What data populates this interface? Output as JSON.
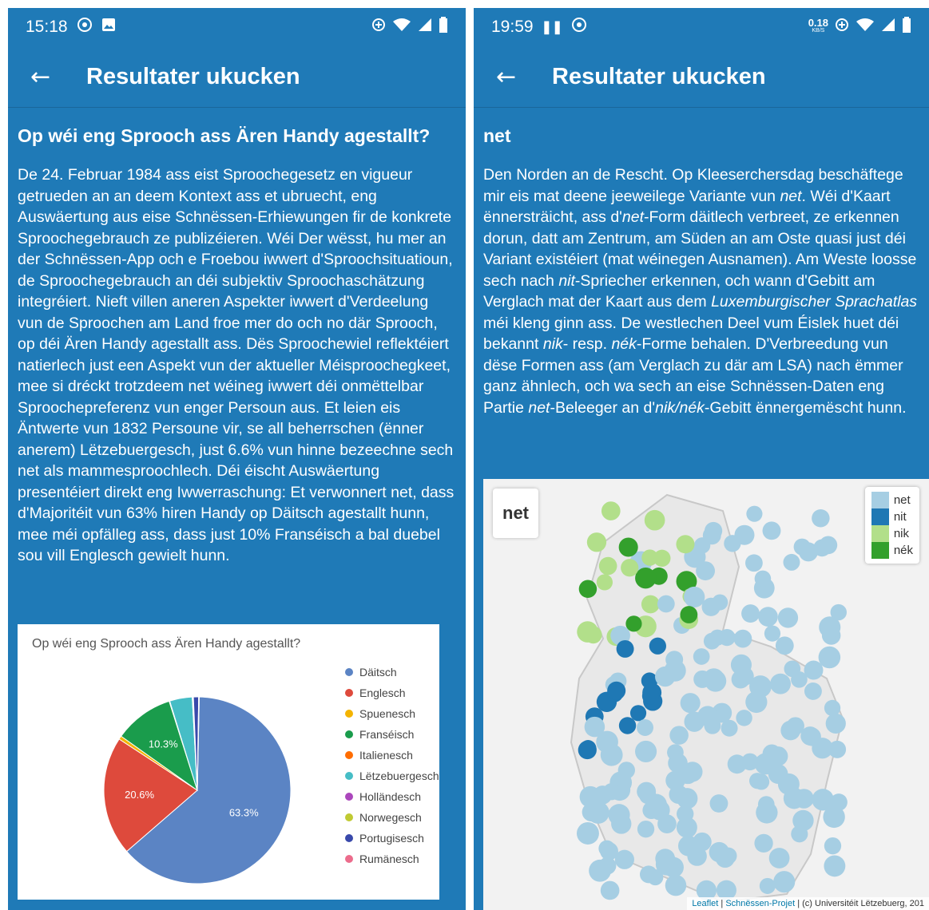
{
  "left": {
    "status": {
      "time": "15:18"
    },
    "appbar": {
      "title": "Resultater ukucken"
    },
    "question": "Op wéi eng Sprooch ass Ären Handy agestallt?",
    "paragraph": "De 24. Februar 1984 ass eist Sproochegesetz en vigueur getrueden an an deem Kontext ass et ubruecht, eng Auswäertung aus eise Schnëssen-Erhiewungen fir de konkrete Sproochegebrauch ze publizéieren. Wéi Der wësst, hu mer an der Schnëssen-App och e Froebou iwwert d'Sproochsituatioun, de Sproochegebrauch an déi subjektiv Sproochaschätzung integréiert. Nieft villen aneren Aspekter iwwert d'Verdeelung vun de Sproochen am Land froe mer do och no där Sprooch, op déi Ären Handy agestallt ass. Dës Sproochewiel reflektéiert natierlech just een Aspekt vun der aktueller Méisproochegkeet, mee si dréckt trotzdeem net wéineg iwwert déi onmëttelbar Sproochepreferenz vun enger Persoun aus. Et leien eis Äntwerte vun 1832 Persoune vir, se all beherrschen (ënner anerem) Lëtzebuergesch, just 6.6% vun hinne bezeechne sech net als mammesproochlech. Déi éischt Auswäertung presentéiert direkt eng Iwwerraschung: Et verwonnert net, dass d'Majoritéit vun 63% hiren Handy op Däitsch agestallt hunn, mee méi opfälleg ass, dass just 10% Franséisch a bal duebel sou vill Englesch gewielt hunn."
  },
  "right": {
    "status": {
      "time": "19:59",
      "speed": "0.18",
      "speed_unit": "KB/S"
    },
    "appbar": {
      "title": "Resultater ukucken"
    },
    "word": "net",
    "paragraph_html": "Den Norden an de Rescht. Op Kleeserchersdag beschäftege mir eis mat deene jeeweilege Variante vun <i>net</i>. Wéi d'Kaart ënnersträicht, ass d'<i>net</i>-Form däitlech verbreet, ze erkennen dorun, datt am Zentrum, am Süden an am Oste quasi just déi Variant existéiert (mat wéinegen Ausnamen). Am Weste loosse sech nach <i>nit</i>-Spriecher erkennen, och wann d'Gebitt am Verglach mat der Kaart aus dem <i>Luxemburgischer Sprachatlas</i> méi kleng ginn ass. De westlechen Deel vum Éislek huet déi bekannt <i>nik</i>- resp. <i>nék</i>-Forme behalen. D'Verbreedung vun dëse Formen ass (am Verglach zu där am LSA) nach ëmmer ganz ähnlech, och wa sech an eise Schnëssen-Daten eng Partie <i>net</i>-Beleeger an d'<i>nik/nék</i>-Gebitt ënnergemëscht hunn.",
    "map": {
      "label": "net",
      "legend": [
        {
          "name": "net",
          "color": "#a6cee3"
        },
        {
          "name": "nit",
          "color": "#1f78b4"
        },
        {
          "name": "nik",
          "color": "#b2df8a"
        },
        {
          "name": "nék",
          "color": "#33a02c"
        }
      ],
      "attribution": {
        "leaflet": "Leaflet",
        "project": "Schnëssen-Projet",
        "rest": "(c) Universitéit Lëtzebuerg, 201"
      }
    }
  },
  "chart_data": {
    "type": "pie",
    "title": "Op wéi eng Sprooch ass Ären Handy agestallt?",
    "categories": [
      "Däitsch",
      "Englesch",
      "Spuenesch",
      "Franséisch",
      "Italienesch",
      "Lëtzebuergesch",
      "Holländesch",
      "Norwegesch",
      "Portugisesch",
      "Rumänesch"
    ],
    "values": [
      63.3,
      20.6,
      0.6,
      10.3,
      0.1,
      3.9,
      0.1,
      0.1,
      0.9,
      0.1
    ],
    "labels": [
      "63.3%",
      "20.6%",
      "",
      "10.3%",
      "",
      "",
      "",
      "",
      "",
      ""
    ],
    "colors": [
      "#5b84c4",
      "#de4a3c",
      "#f4b400",
      "#1a9c4c",
      "#ff6d00",
      "#46bdc6",
      "#ab47bc",
      "#c0ca33",
      "#3949ab",
      "#ec6c8c"
    ],
    "legend_position": "right"
  }
}
